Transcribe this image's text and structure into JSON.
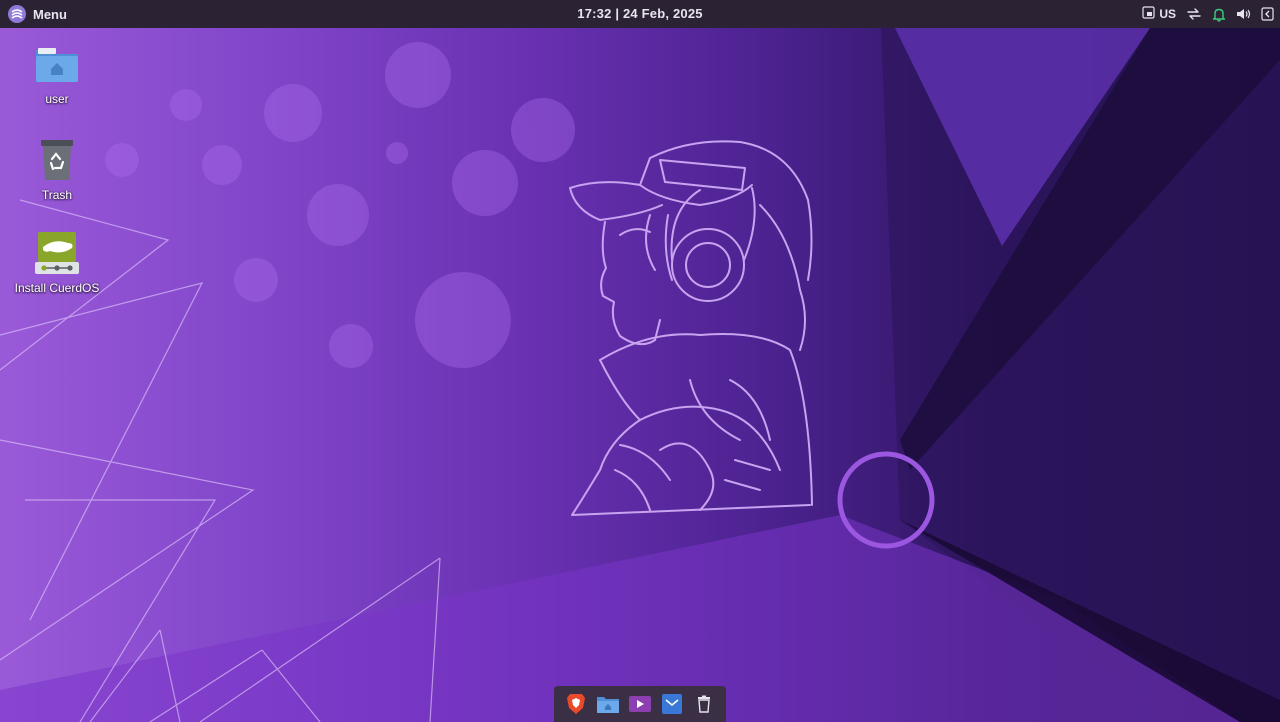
{
  "panel": {
    "menu_label": "Menu",
    "clock": "17:32 | 24 Feb, 2025",
    "keyboard_layout": "US",
    "tray_icons": [
      "keyboard-icon",
      "network-transfer-icon",
      "notification-bell-icon",
      "volume-icon",
      "logout-icon"
    ]
  },
  "desktop_icons": [
    {
      "label": "user",
      "icon": "home-folder-icon"
    },
    {
      "label": "Trash",
      "icon": "trash-icon"
    },
    {
      "label": "Install CuerdOS",
      "icon": "installer-icon"
    }
  ],
  "dock": {
    "items": [
      "brave-browser-icon",
      "file-manager-icon",
      "media-player-icon",
      "mail-icon",
      "trash-icon"
    ]
  },
  "colors": {
    "panel_bg": "#2b2334",
    "dock_bg": "#3a2f45",
    "wallpaper_light": "#9a5ad8",
    "wallpaper_dark": "#241250",
    "line_art": "#c7a3f0",
    "bell_green": "#3ec97b"
  }
}
